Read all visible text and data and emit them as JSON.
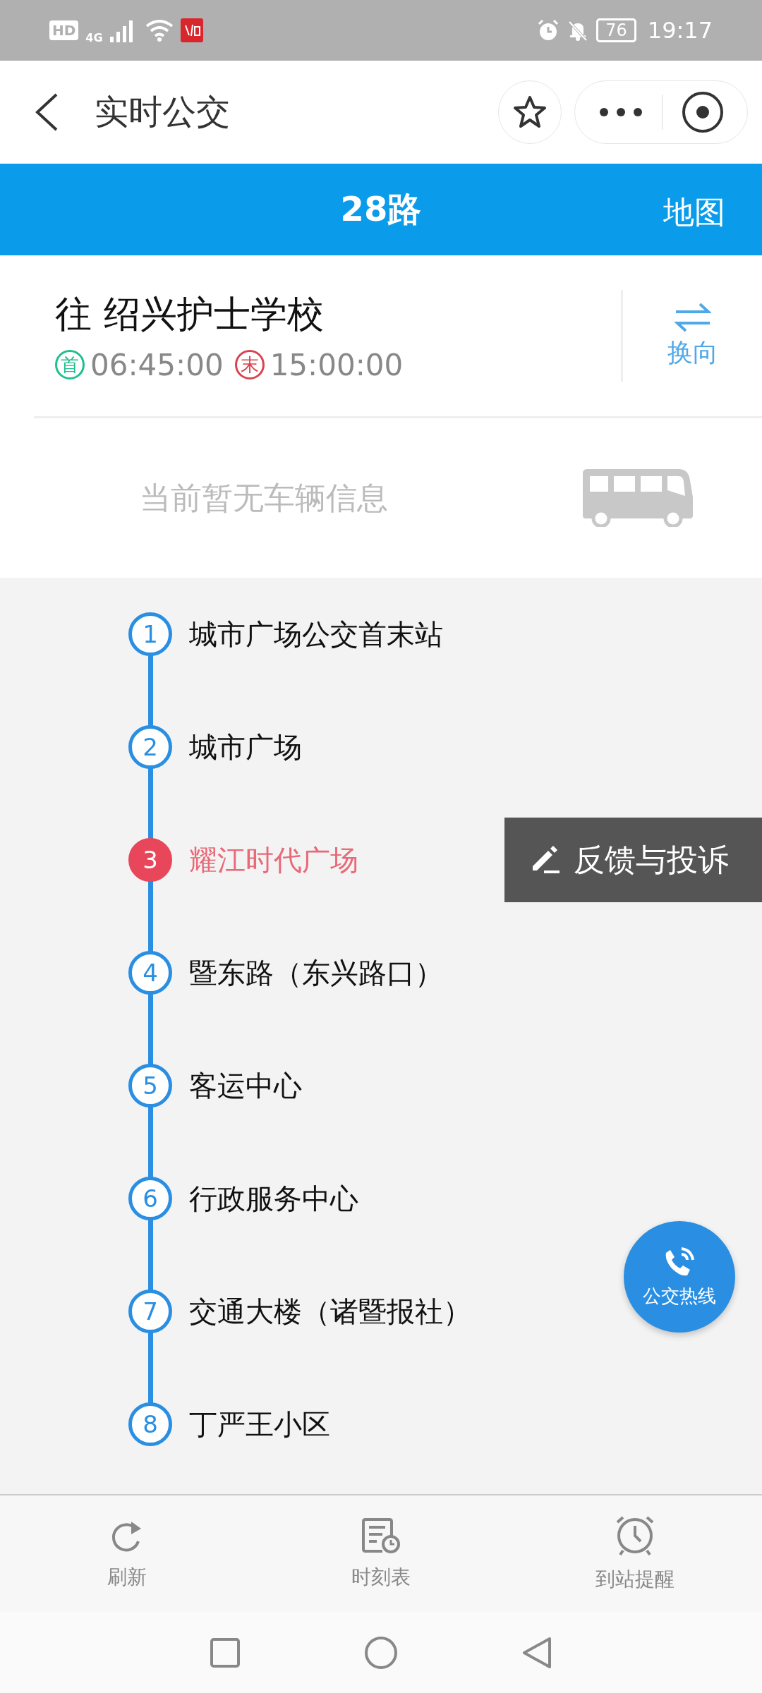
{
  "status_bar": {
    "hd": "HD",
    "network": "4G",
    "battery": "76",
    "time": "19:17"
  },
  "header": {
    "title": "实时公交"
  },
  "route_bar": {
    "route": "28路",
    "map_link": "地图"
  },
  "direction": {
    "destination": "往 绍兴护士学校",
    "first_badge": "首",
    "first_time": "06:45:00",
    "last_badge": "末",
    "last_time": "15:00:00",
    "switch_label": "换向"
  },
  "vehicle_info": "当前暂无车辆信息",
  "stations": [
    {
      "number": "1",
      "name": "城市广场公交首末站",
      "selected": false
    },
    {
      "number": "2",
      "name": "城市广场",
      "selected": false
    },
    {
      "number": "3",
      "name": "耀江时代广场",
      "selected": true
    },
    {
      "number": "4",
      "name": "暨东路（东兴路口）",
      "selected": false
    },
    {
      "number": "5",
      "name": "客运中心",
      "selected": false
    },
    {
      "number": "6",
      "name": "行政服务中心",
      "selected": false
    },
    {
      "number": "7",
      "name": "交通大楼（诸暨报社）",
      "selected": false
    },
    {
      "number": "8",
      "name": "丁严王小区",
      "selected": false
    }
  ],
  "feedback_button": "反馈与投诉",
  "hotline_button": "公交热线",
  "bottom_tabs": [
    {
      "label": "刷新",
      "kind": "refresh"
    },
    {
      "label": "时刻表",
      "kind": "timetable"
    },
    {
      "label": "到站提醒",
      "kind": "alarm"
    }
  ]
}
